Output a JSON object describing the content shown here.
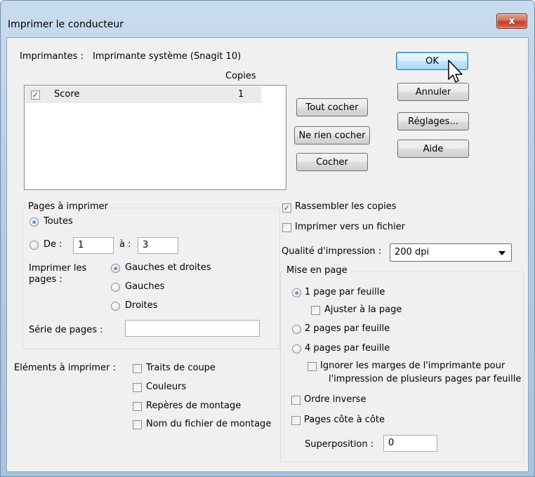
{
  "window": {
    "title": "Imprimer le conducteur",
    "close_glyph": "x"
  },
  "printers": {
    "label": "Imprimantes :",
    "value": "Imprimante système (Snagit 10)"
  },
  "copies_header": "Copies",
  "score_list": [
    {
      "name": "Score",
      "copies": "1",
      "checked": true
    }
  ],
  "list_buttons": {
    "check_all": "Tout cocher",
    "uncheck_all": "Ne rien cocher",
    "check": "Cocher"
  },
  "dialog_buttons": {
    "ok": "OK",
    "cancel": "Annuler",
    "settings": "Réglages...",
    "help": "Aide"
  },
  "pages_group": {
    "title": "Pages à imprimer",
    "all_label": "Toutes",
    "from_label": "De :",
    "from_value": "1",
    "to_label": "à :",
    "to_value": "3",
    "print_label": "Imprimer les pages :",
    "opt_both": "Gauches et droites",
    "opt_left": "Gauches",
    "opt_right": "Droites",
    "series_label": "Série de pages :",
    "series_value": ""
  },
  "elements": {
    "label": "Eléments à imprimer :",
    "crop_marks": "Traits de coupe",
    "colors": "Couleurs",
    "registration": "Repères de montage",
    "file_name": "Nom du fichier de montage"
  },
  "options": {
    "collate": "Rassembler les copies",
    "print_to_file": "Imprimer vers un fichier",
    "quality_label": "Qualité d'impression :",
    "quality_value": "200 dpi"
  },
  "layout_group": {
    "title": "Mise en page",
    "one_page": "1 page par feuille",
    "fit_page": "Ajuster à la page",
    "two_pages": "2 pages par feuille",
    "four_pages": "4 pages par feuille",
    "ignore_margins_1": "Ignorer les marges de l'imprimante pour",
    "ignore_margins_2": "l'impression de plusieurs pages par feuille",
    "reverse": "Ordre inverse",
    "side_by_side": "Pages côte à côte",
    "overlap_label": "Superposition :",
    "overlap_value": "0"
  }
}
